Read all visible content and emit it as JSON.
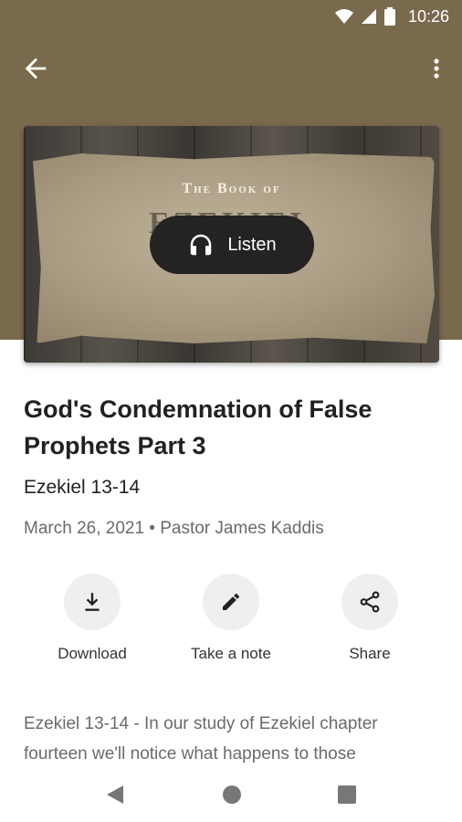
{
  "status_bar": {
    "time": "10:26"
  },
  "appbar": {
    "back_icon": "arrow-left-icon",
    "more_icon": "more-vert-icon"
  },
  "artwork": {
    "line1": "The Book of",
    "line2": "EZEKIEL",
    "listen_label": "Listen",
    "listen_icon": "headphones-icon"
  },
  "sermon": {
    "title": "God's Condemnation of False Prophets Part 3",
    "scripture": "Ezekiel 13-14",
    "meta": "March 26, 2021 • Pastor James Kaddis"
  },
  "actions": [
    {
      "label": "Download",
      "icon": "download-icon"
    },
    {
      "label": "Take a note",
      "icon": "pencil-icon"
    },
    {
      "label": "Share",
      "icon": "share-icon"
    }
  ],
  "description": "Ezekiel 13-14 - In our study of Ezekiel chapter fourteen we'll notice what happens to those",
  "colors": {
    "header": "#7a6a4d",
    "pill": "#242322",
    "action_circle": "#efefef"
  },
  "navbar": {
    "back_icon": "nav-back-icon",
    "home_icon": "nav-home-icon",
    "recents_icon": "nav-recents-icon"
  }
}
